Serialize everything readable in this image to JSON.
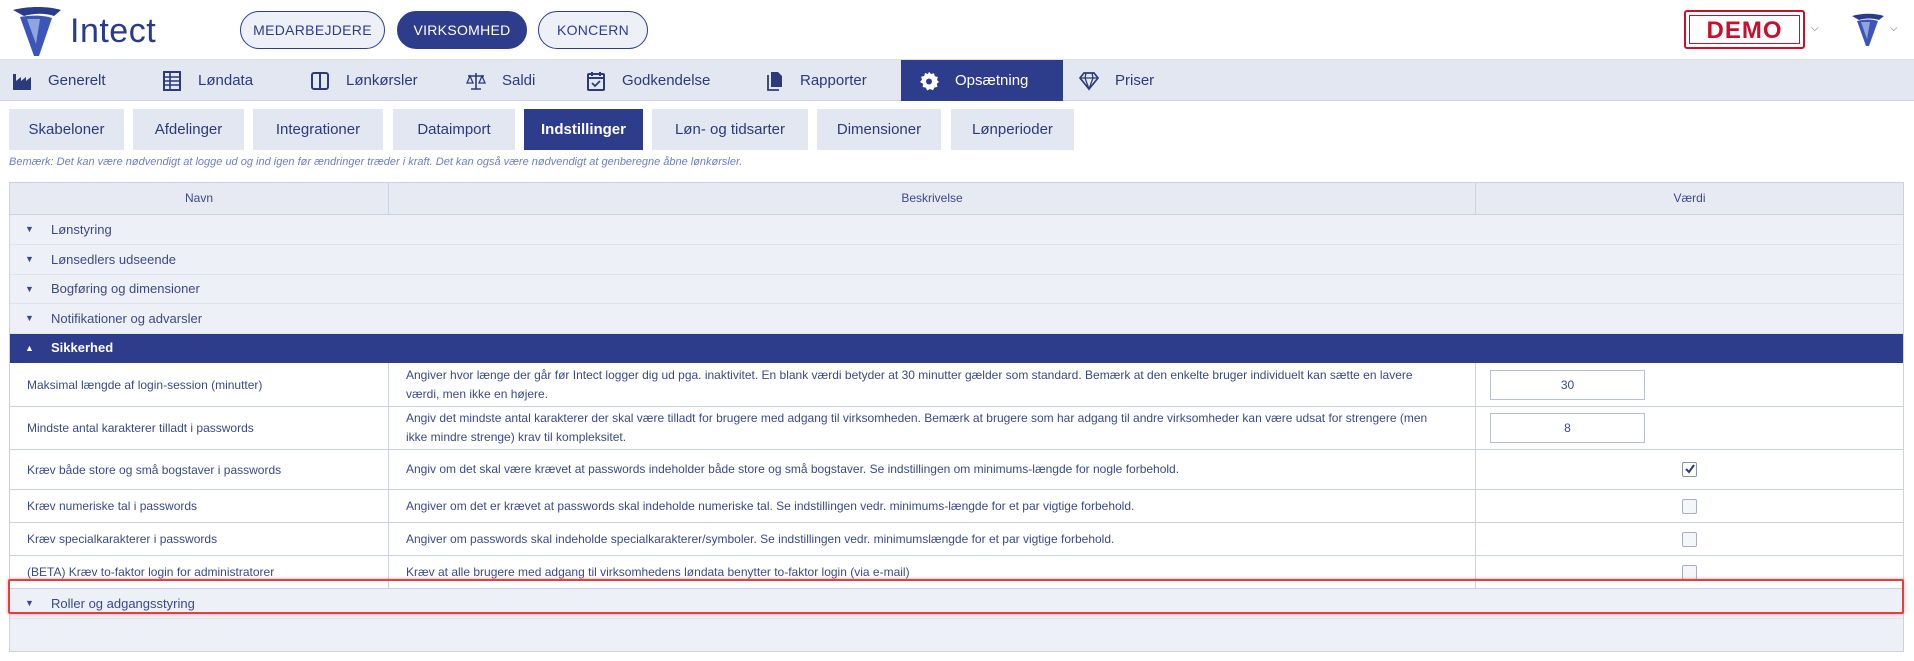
{
  "app": {
    "name": "Intect"
  },
  "top_nav": [
    {
      "label": "MEDARBEJDERE",
      "active": false
    },
    {
      "label": "VIRKSOMHED",
      "active": true
    },
    {
      "label": "KONCERN",
      "active": false
    }
  ],
  "header": {
    "demo_label": "DEMO"
  },
  "main_nav": [
    {
      "label": "Generelt",
      "icon": "factory-icon",
      "active": false
    },
    {
      "label": "Løndata",
      "icon": "spreadsheet-icon",
      "active": false
    },
    {
      "label": "Lønkørsler",
      "icon": "columns-icon",
      "active": false
    },
    {
      "label": "Saldi",
      "icon": "scale-icon",
      "active": false
    },
    {
      "label": "Godkendelse",
      "icon": "calendar-check-icon",
      "active": false
    },
    {
      "label": "Rapporter",
      "icon": "documents-icon",
      "active": false
    },
    {
      "label": "Opsætning",
      "icon": "gear-icon",
      "active": true
    },
    {
      "label": "Priser",
      "icon": "diamond-icon",
      "active": false
    }
  ],
  "sub_tabs": [
    {
      "label": "Skabeloner",
      "active": false
    },
    {
      "label": "Afdelinger",
      "active": false
    },
    {
      "label": "Integrationer",
      "active": false
    },
    {
      "label": "Dataimport",
      "active": false
    },
    {
      "label": "Indstillinger",
      "active": true
    },
    {
      "label": "Løn- og tidsarter",
      "active": false
    },
    {
      "label": "Dimensioner",
      "active": false
    },
    {
      "label": "Lønperioder",
      "active": false
    }
  ],
  "note": "Bemærk: Det kan være nødvendigt at logge ud og ind igen før ændringer træder i kraft. Det kan også være nødvendigt at genberegne åbne lønkørsler.",
  "table": {
    "columns": [
      "Navn",
      "Beskrivelse",
      "Værdi"
    ],
    "groups_top": [
      {
        "label": "Lønstyring"
      },
      {
        "label": "Lønsedlers udseende"
      },
      {
        "label": "Bogføring og dimensioner"
      },
      {
        "label": "Notifikationer og advarsler"
      }
    ],
    "open_group": {
      "label": "Sikkerhed"
    },
    "rows": [
      {
        "name": "Maksimal længde af login-session (minutter)",
        "description": "Angiver hvor længe der går før Intect logger dig ud pga. inaktivitet. En blank værdi betyder at 30 minutter gælder som standard. Bemærk at den enkelte bruger individuelt kan sætte en lavere værdi, men ikke en højere.",
        "value": "30",
        "type": "number"
      },
      {
        "name": "Mindste antal karakterer tilladt i passwords",
        "description": "Angiv det mindste antal karakterer der skal være tilladt for brugere med adgang til virksomheden. Bemærk at brugere som har adgang til andre virksomheder kan være udsat for strengere (men ikke mindre strenge) krav til kompleksitet.",
        "value": "8",
        "type": "number"
      },
      {
        "name": "Kræv både store og små bogstaver i passwords",
        "description": "Angiv om det skal være krævet at passwords indeholder både store og små bogstaver. Se indstillingen om minimums-længde for nogle forbehold.",
        "checked": true,
        "type": "checkbox"
      },
      {
        "name": "Kræv numeriske tal i passwords",
        "description": "Angiver om det er krævet at passwords skal indeholde numeriske tal. Se indstillingen vedr. minimums-længde for et par vigtige forbehold.",
        "checked": false,
        "type": "checkbox"
      },
      {
        "name": "Kræv specialkarakterer i passwords",
        "description": "Angiver om passwords skal indeholde specialkarakterer/symboler. Se indstillingen vedr. minimumslængde for et par vigtige forbehold.",
        "checked": false,
        "type": "checkbox"
      },
      {
        "name": "(BETA) Kræv to-faktor login for administratorer",
        "description": "Kræv at alle brugere med adgang til virksomhedens løndata benytter to-faktor login (via e-mail)",
        "checked": false,
        "type": "checkbox"
      }
    ],
    "groups_bottom": [
      {
        "label": "Roller og adgangsstyring"
      }
    ]
  }
}
